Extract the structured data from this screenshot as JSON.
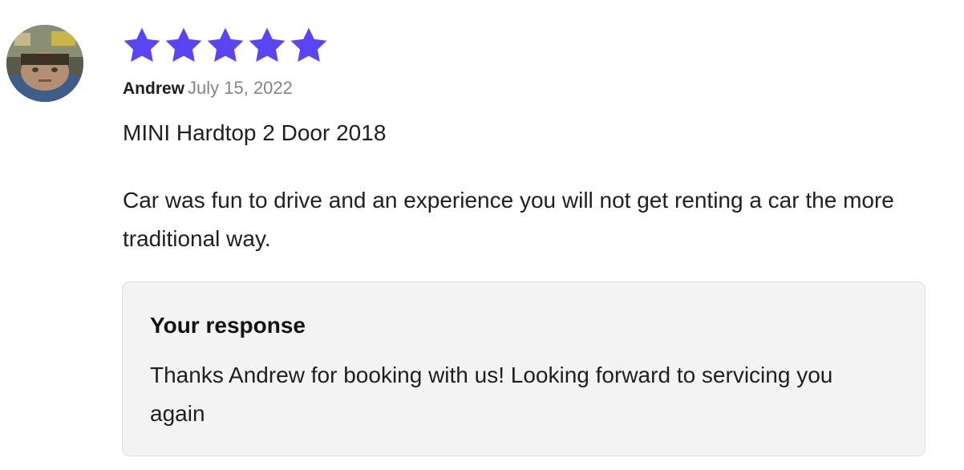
{
  "review": {
    "avatar_icon": "reviewer-avatar-photo",
    "rating": 5,
    "max_rating": 5,
    "star_color": "#5a45f5",
    "reviewer_name": "Andrew",
    "date": "July 15, 2022",
    "vehicle": "MINI Hardtop 2 Door 2018",
    "text": "Car was fun to drive and an experience you will not get renting a car the more traditional way."
  },
  "response": {
    "title": "Your response",
    "text": "Thanks Andrew for booking with us! Looking forward to servicing you again"
  }
}
